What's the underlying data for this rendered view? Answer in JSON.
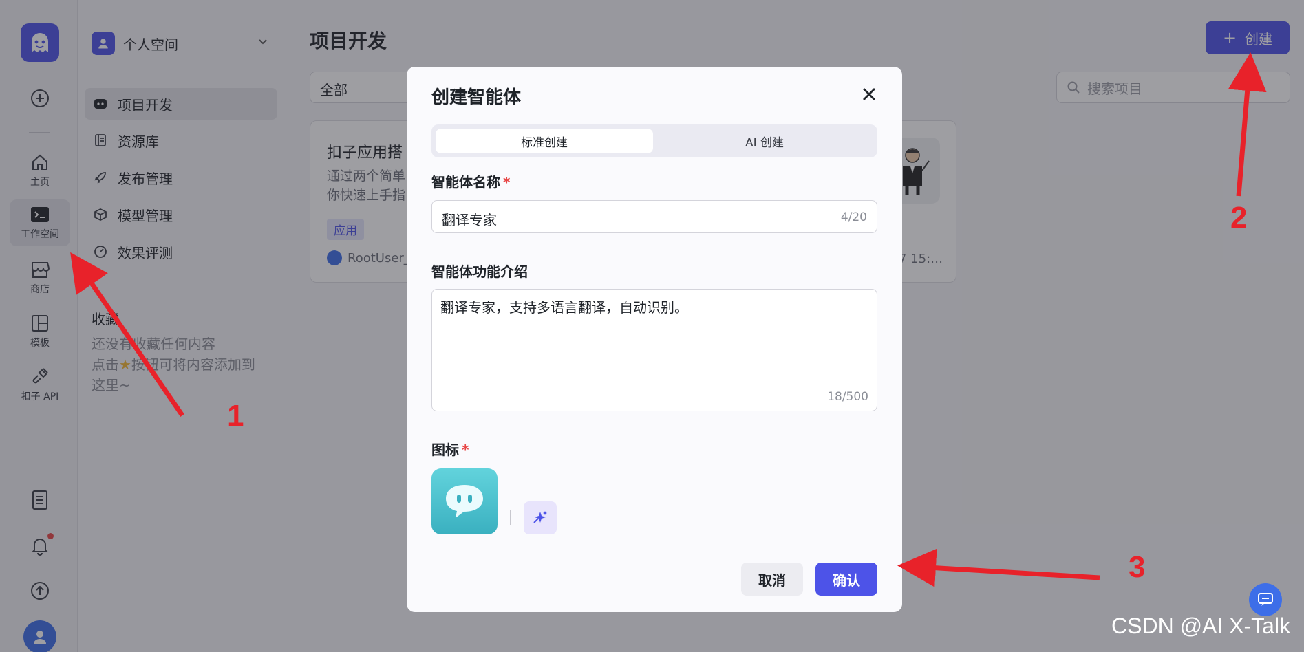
{
  "rail": {
    "items": [
      {
        "label": ""
      },
      {
        "label": "主页"
      },
      {
        "label": "工作空间"
      },
      {
        "label": "商店"
      },
      {
        "label": "模板"
      },
      {
        "label": "扣子 API"
      }
    ]
  },
  "sidebar": {
    "space_name": "个人空间",
    "nav": [
      {
        "label": "项目开发",
        "icon": "project-icon"
      },
      {
        "label": "资源库",
        "icon": "library-icon"
      },
      {
        "label": "发布管理",
        "icon": "rocket-icon"
      },
      {
        "label": "模型管理",
        "icon": "cube-icon"
      },
      {
        "label": "效果评测",
        "icon": "gauge-icon"
      }
    ],
    "favorites_title": "收藏",
    "favorites_empty_1": "还没有收藏任何内容",
    "favorites_empty_2": "点击",
    "favorites_empty_3": "按钮可将内容添加到",
    "favorites_empty_4": "这里~"
  },
  "main": {
    "title": "项目开发",
    "create_label": "创建",
    "filter_value": "全部",
    "search_placeholder": "搜索项目",
    "card": {
      "title": "扣子应用搭",
      "desc_1": "通过两个简单",
      "desc_2": "你快速上手指",
      "tag": "应用",
      "user": "RootUser_",
      "time": "7 15:…"
    }
  },
  "modal": {
    "title": "创建智能体",
    "tabs": [
      "标准创建",
      "AI 创建"
    ],
    "name_label": "智能体名称",
    "name_value": "翻译专家",
    "name_counter": "4/20",
    "desc_label": "智能体功能介绍",
    "desc_value": "翻译专家，支持多语言翻译，自动识别。",
    "desc_counter": "18/500",
    "icon_label": "图标",
    "required_mark": "*",
    "cancel_label": "取消",
    "confirm_label": "确认"
  },
  "annotations": [
    "1",
    "2",
    "3"
  ],
  "watermark": "CSDN @AI X-Talk",
  "colors": {
    "accent": "#4d53e8",
    "annotation": "#e8222a",
    "required": "#e84545"
  }
}
